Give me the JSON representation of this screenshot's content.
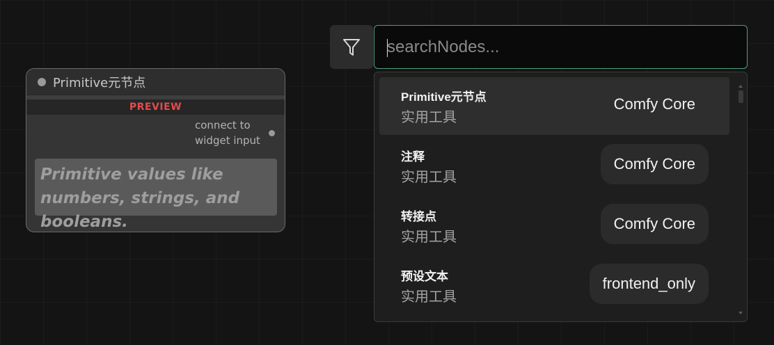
{
  "node": {
    "title": "Primitive元节点",
    "preview_label": "PREVIEW",
    "output_label": "connect to widget input",
    "description": "Primitive values like numbers, strings, and booleans."
  },
  "search": {
    "placeholder": "searchNodes...",
    "value": "",
    "filter_icon": "filter-icon"
  },
  "results": [
    {
      "name": "Primitive元节点",
      "category": "实用工具",
      "source": "Comfy Core",
      "selected": true
    },
    {
      "name": "注释",
      "category": "实用工具",
      "source": "Comfy Core",
      "selected": false
    },
    {
      "name": "转接点",
      "category": "实用工具",
      "source": "Comfy Core",
      "selected": false
    },
    {
      "name": "预设文本",
      "category": "实用工具",
      "source": "frontend_only",
      "selected": false
    }
  ],
  "colors": {
    "background": "#141414",
    "search_border": "#4fa079",
    "preview_label": "#e34b4b"
  }
}
